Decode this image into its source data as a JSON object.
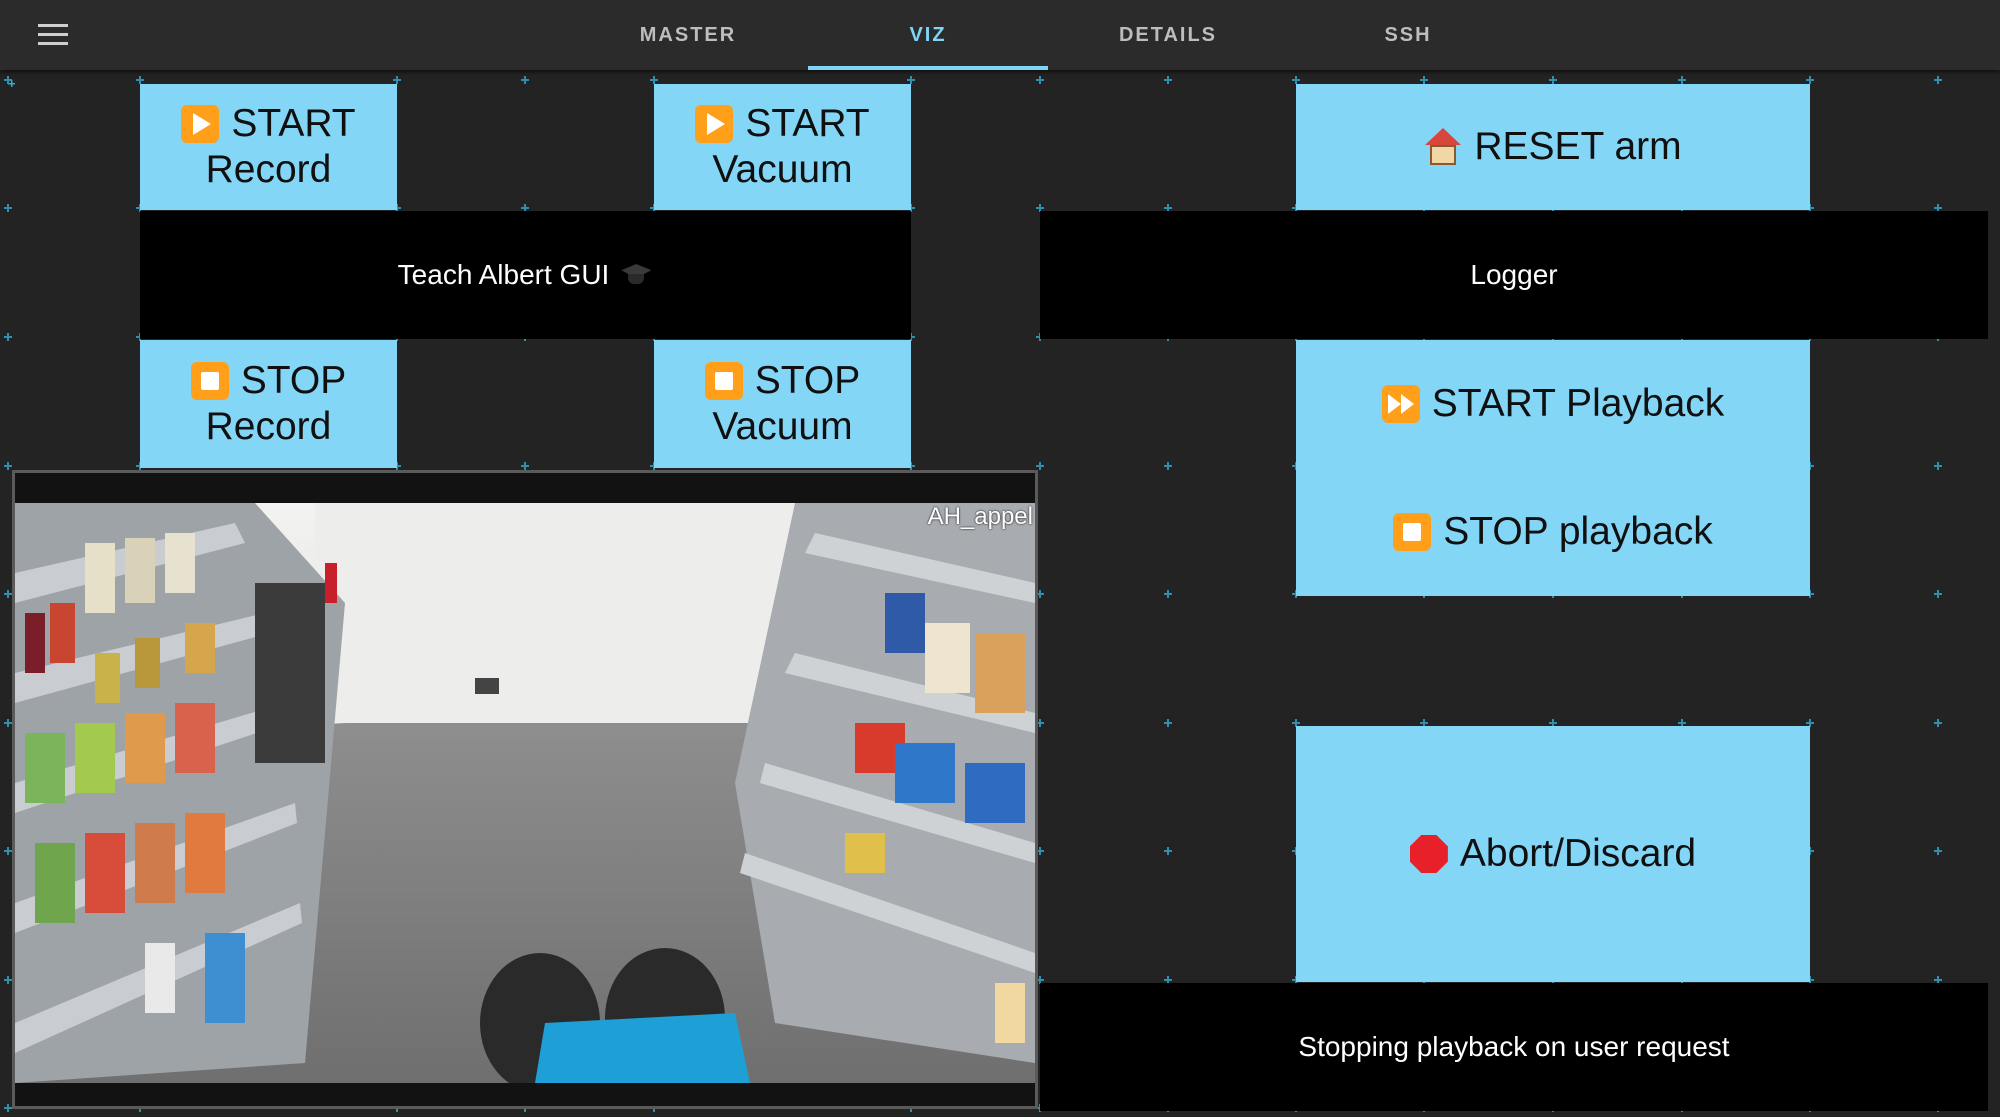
{
  "nav": {
    "menu_icon": "hamburger-menu-icon",
    "tabs": [
      {
        "label": "MASTER",
        "active": false
      },
      {
        "label": "VIZ",
        "active": true
      },
      {
        "label": "DETAILS",
        "active": false
      },
      {
        "label": "SSH",
        "active": false
      }
    ]
  },
  "colors": {
    "background": "#232323",
    "button": "#84d6f7",
    "accent": "#7fd4f6",
    "bar": "#000000"
  },
  "left": {
    "start_record": {
      "icon": "play-button-icon",
      "line1": "START",
      "line2": "Record"
    },
    "start_vacuum": {
      "icon": "play-button-icon",
      "line1": "START",
      "line2": "Vacuum"
    },
    "title": {
      "text": "Teach Albert GUI",
      "icon": "graduation-cap-icon"
    },
    "stop_record": {
      "icon": "stop-button-icon",
      "line1": "STOP",
      "line2": "Record"
    },
    "stop_vacuum": {
      "icon": "stop-button-icon",
      "line1": "STOP",
      "line2": "Vacuum"
    },
    "camera": {
      "label": "AH_appel"
    }
  },
  "right": {
    "reset_arm": {
      "icon": "house-icon",
      "label": "RESET arm"
    },
    "logger_title": "Logger",
    "start_playback": {
      "icon": "fast-forward-icon",
      "label": "START Playback"
    },
    "stop_playback": {
      "icon": "stop-button-icon",
      "label": "STOP playback"
    },
    "abort": {
      "icon": "stop-sign-icon",
      "label": "Abort/Discard"
    },
    "log_message": "Stopping playback on user request"
  }
}
